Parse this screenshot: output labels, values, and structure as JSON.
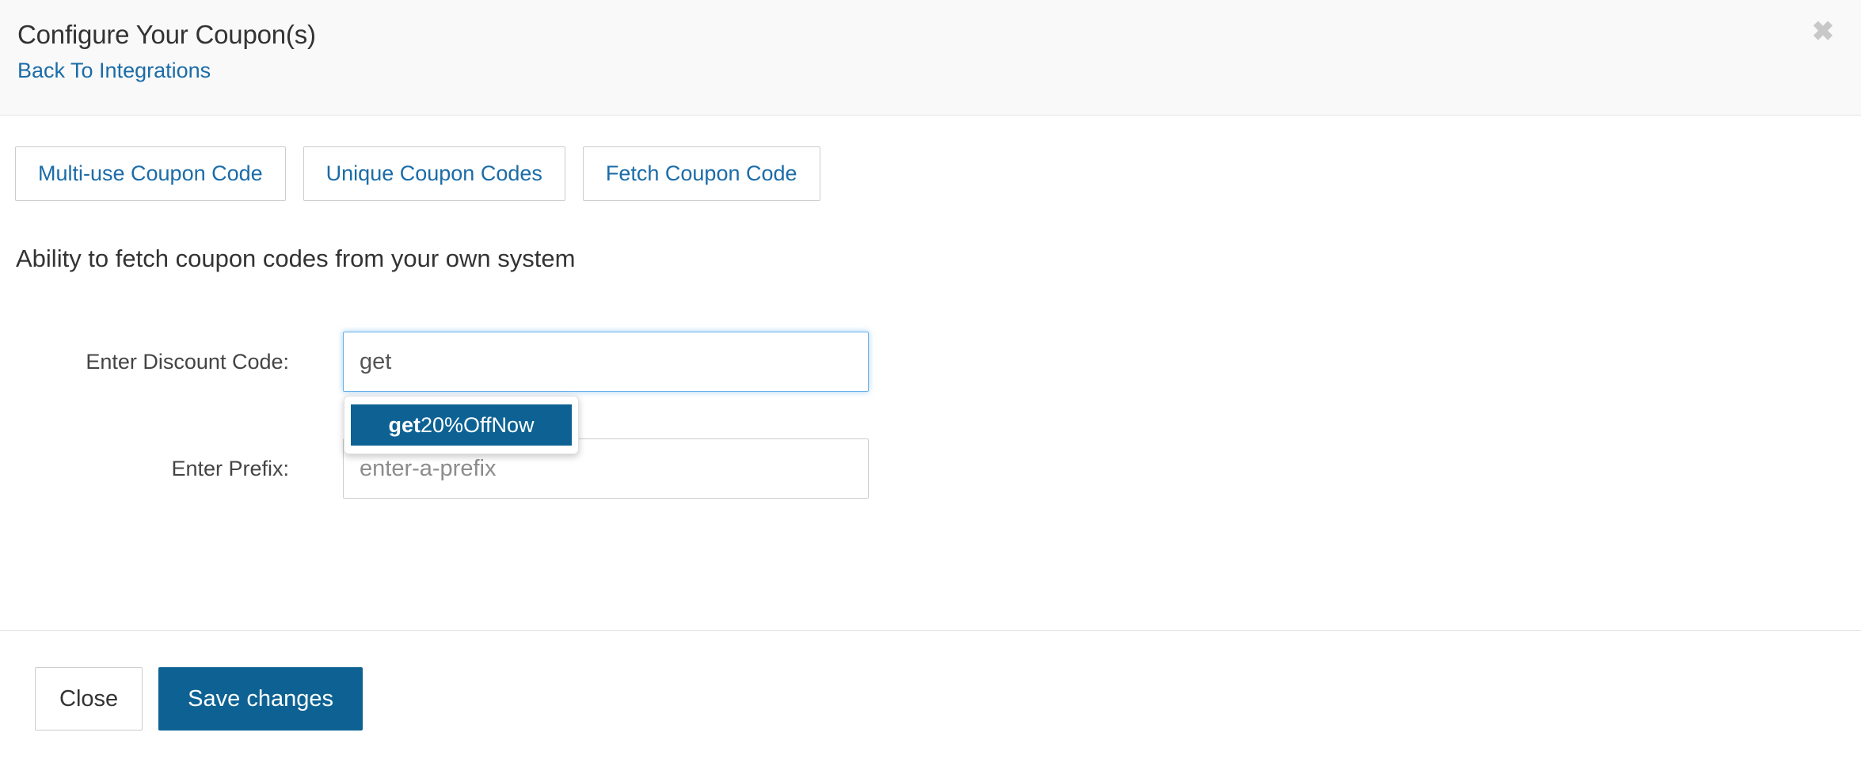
{
  "header": {
    "title": "Configure Your Coupon(s)",
    "back_link": "Back To Integrations",
    "close_icon": "close-icon",
    "close_glyph": "✖"
  },
  "tabs": [
    {
      "label": "Multi-use Coupon Code",
      "selected": false
    },
    {
      "label": "Unique Coupon Codes",
      "selected": false
    },
    {
      "label": "Fetch Coupon Code",
      "selected": true
    }
  ],
  "main": {
    "section_heading": "Ability to fetch coupon codes from your own system",
    "fields": [
      {
        "label": "Enter Discount Code:",
        "value": "get",
        "placeholder": "",
        "focused": true
      },
      {
        "label": "Enter Prefix:",
        "value": "",
        "placeholder": "enter-a-prefix",
        "focused": false
      }
    ],
    "autocomplete": {
      "visible": true,
      "items": [
        {
          "match": "get",
          "rest": "20%OffNow",
          "highlighted": true
        }
      ]
    }
  },
  "footer": {
    "close_label": "Close",
    "save_label": "Save changes"
  },
  "colors": {
    "accent_blue": "#0d6293",
    "link_blue": "#1b6ca8",
    "focus_border": "#66afe9",
    "border_gray": "#cccccc",
    "header_bg": "#f9f9f9"
  }
}
